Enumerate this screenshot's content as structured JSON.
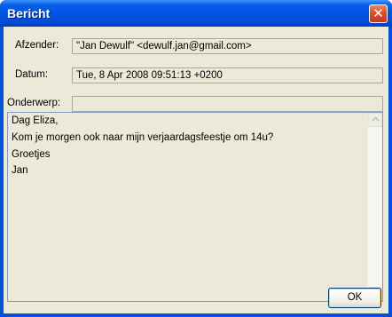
{
  "window": {
    "title": "Bericht",
    "close_glyph": "✕"
  },
  "fields": {
    "from_label": "Afzender:",
    "from_value": "\"Jan Dewulf\" <dewulf.jan@gmail.com>",
    "date_label": "Datum:",
    "date_value": "Tue, 8 Apr 2008 09:51:13 +0200",
    "subject_label": "Onderwerp:",
    "subject_value": ""
  },
  "message": {
    "lines": [
      "Dag Eliza,",
      "Kom je morgen ook naar mijn verjaardagsfeestje om 14u?",
      "Groetjes",
      "Jan"
    ]
  },
  "buttons": {
    "ok_label": "OK"
  },
  "colors": {
    "titlebar": "#0054e3",
    "dialog_bg": "#ece9d8",
    "close_button": "#d6502e"
  },
  "icons": {
    "close": "close-icon",
    "scroll_up": "chevron-up-icon",
    "scroll_down": "chevron-down-icon"
  }
}
